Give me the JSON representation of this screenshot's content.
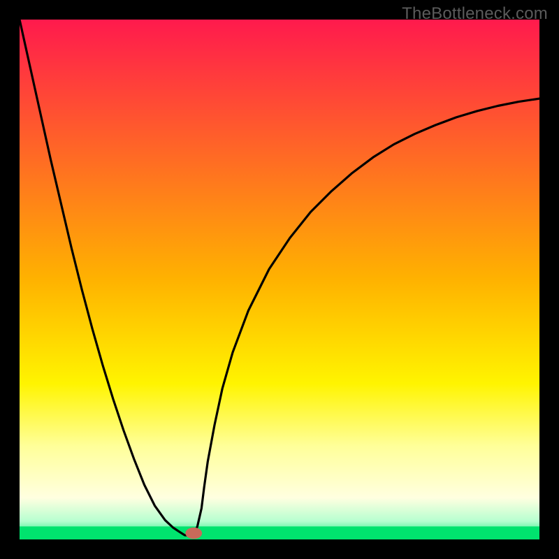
{
  "watermark": "TheBottleneck.com",
  "chart_data": {
    "type": "line",
    "title": "",
    "xlabel": "",
    "ylabel": "",
    "xlim": [
      0,
      100
    ],
    "ylim": [
      0,
      100
    ],
    "grid": false,
    "legend": false,
    "background_gradient": {
      "stops": [
        {
          "offset": 0.0,
          "color": "#ff1a4d"
        },
        {
          "offset": 0.5,
          "color": "#ffb200"
        },
        {
          "offset": 0.7,
          "color": "#fff400"
        },
        {
          "offset": 0.82,
          "color": "#ffff99"
        },
        {
          "offset": 0.92,
          "color": "#ffffe0"
        },
        {
          "offset": 0.965,
          "color": "#b6ffd0"
        },
        {
          "offset": 1.0,
          "color": "#00e36e"
        }
      ]
    },
    "bottom_band": {
      "y_from": 97.5,
      "y_to": 100,
      "color": "#00e36e"
    },
    "marker": {
      "x": 33.5,
      "y": 98.8,
      "color": "#c96a5a",
      "rx": 1.6,
      "ry": 1.1
    },
    "series": [
      {
        "name": "curve",
        "color": "#000000",
        "x": [
          0,
          2,
          4,
          6,
          8,
          10,
          12,
          14,
          16,
          18,
          20,
          22,
          24,
          26,
          28,
          29.5,
          31,
          31.8,
          32.6,
          33.4,
          34.2,
          35,
          35.5,
          36.2,
          37.5,
          39,
          41,
          44,
          48,
          52,
          56,
          60,
          64,
          68,
          72,
          76,
          80,
          84,
          88,
          92,
          96,
          100
        ],
        "y": [
          0,
          9,
          18,
          27,
          35.5,
          44,
          52,
          59.5,
          66.5,
          73,
          79,
          84.5,
          89.5,
          93.5,
          96.3,
          97.7,
          98.7,
          99.2,
          99.2,
          99.2,
          97.5,
          94,
          90,
          85,
          78,
          71,
          64,
          56,
          48,
          42,
          37,
          33,
          29.5,
          26.5,
          24,
          22,
          20.3,
          18.8,
          17.6,
          16.6,
          15.8,
          15.2
        ]
      }
    ]
  }
}
